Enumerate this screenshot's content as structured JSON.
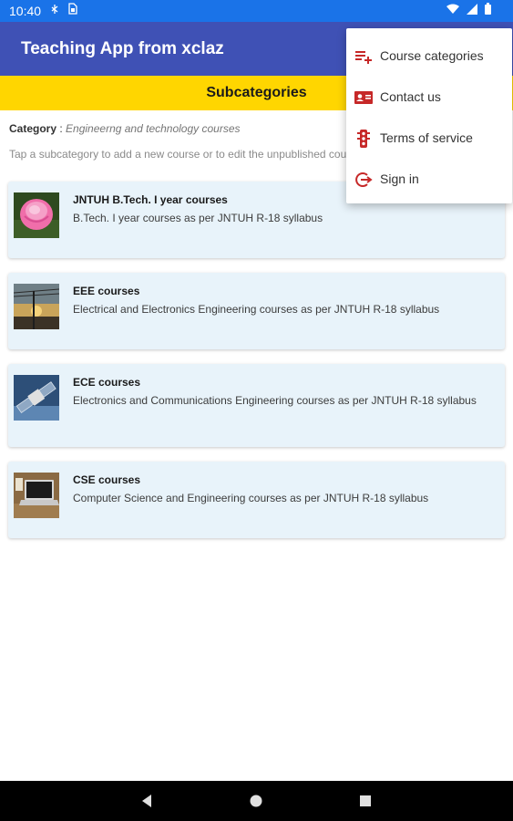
{
  "status_bar": {
    "time": "10:40",
    "left_icons": [
      "sync-off-icon",
      "sim-card-icon"
    ],
    "right_icons": [
      "wifi-icon",
      "cell-signal-icon",
      "battery-icon"
    ],
    "background": "#1a73e8"
  },
  "app_bar": {
    "title": "Teaching App from xclaz",
    "background": "#3f51b5"
  },
  "subcategories": {
    "title": "Subcategories",
    "background": "#ffd600"
  },
  "category": {
    "label": "Category",
    "colon": " :  ",
    "value": "Engineerng and technology courses"
  },
  "hint": "Tap a subcategory to add a new course or to edit the unpublished courses",
  "cards": [
    {
      "title": "JNTUH B.Tech. I year courses",
      "description": "B.Tech. I year courses as per JNTUH R-18 syllabus",
      "thumbnail": "pink-rose-image"
    },
    {
      "title": "EEE courses",
      "description": "Electrical and Electronics Engineering courses as per JNTUH R-18 syllabus",
      "thumbnail": "power-lines-image"
    },
    {
      "title": "ECE courses",
      "description": "Electronics and Communications Engineering courses as per JNTUH R-18 syllabus",
      "thumbnail": "satellite-image"
    },
    {
      "title": "CSE courses",
      "description": "Computer Science and Engineering courses as per JNTUH R-18 syllabus",
      "thumbnail": "laptop-image"
    }
  ],
  "card_background": "#e8f3fa",
  "menu": {
    "items": [
      {
        "label": "Course categories",
        "icon": "playlist-add-icon"
      },
      {
        "label": "Contact us",
        "icon": "contact-card-icon"
      },
      {
        "label": "Terms of service",
        "icon": "traffic-light-icon"
      },
      {
        "label": "Sign in",
        "icon": "login-icon"
      }
    ],
    "icon_color": "#c62828"
  },
  "nav_bar": {
    "buttons": [
      "back-icon",
      "home-icon",
      "recents-icon"
    ]
  }
}
